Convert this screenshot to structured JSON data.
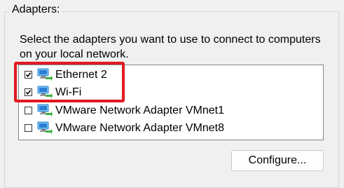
{
  "group": {
    "title": "Adapters:"
  },
  "description": "Select the adapters you want to use to connect to computers on your local network.",
  "adapters": [
    {
      "label": "Ethernet 2",
      "checked": true,
      "icon": "network-adapter-icon"
    },
    {
      "label": "Wi-Fi",
      "checked": true,
      "icon": "network-adapter-icon"
    },
    {
      "label": "VMware Network Adapter VMnet1",
      "checked": false,
      "icon": "network-adapter-icon"
    },
    {
      "label": "VMware Network Adapter VMnet8",
      "checked": false,
      "icon": "network-adapter-icon"
    }
  ],
  "buttons": {
    "configure": "Configure..."
  },
  "colors": {
    "highlight": "#e01a22",
    "icon_blue": "#2a7fd4",
    "icon_green": "#3cb043"
  }
}
